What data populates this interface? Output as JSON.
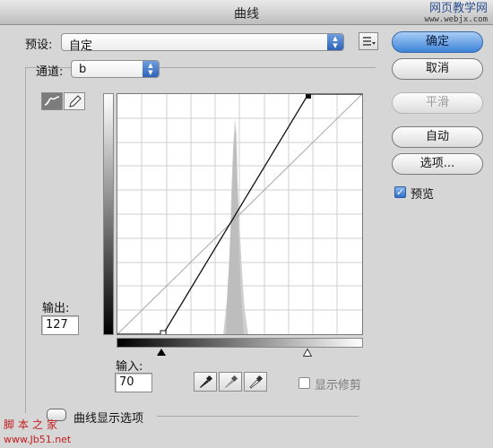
{
  "window": {
    "title": "曲线"
  },
  "watermarks": {
    "top_right": "网页教学网",
    "top_right_url": "www.webjx.com",
    "bottom_left": "脚本之家",
    "bottom_left_url": "www.Jb51.net"
  },
  "preset": {
    "label": "预设:",
    "value": "自定"
  },
  "channel": {
    "label": "通道:",
    "value": "b"
  },
  "buttons": {
    "ok": "确定",
    "cancel": "取消",
    "smooth": "平滑",
    "auto": "自动",
    "options": "选项..."
  },
  "preview": {
    "label": "预览",
    "checked": true
  },
  "output": {
    "label": "输出:",
    "value": "127"
  },
  "input": {
    "label": "输入:",
    "value": "70"
  },
  "show_clipping": {
    "label": "显示修剪",
    "checked": false
  },
  "curve_display_options": {
    "label": "曲线显示选项"
  },
  "icons": {
    "curve_tool": "curve-icon",
    "pencil_tool": "pencil-icon",
    "list_menu": "list-menu-icon",
    "black_point": "eyedropper-black-icon",
    "gray_point": "eyedropper-gray-icon",
    "white_point": "eyedropper-white-icon"
  },
  "colors": {
    "accent": "#3d83d8",
    "title_bg": "#d0d0d0"
  }
}
